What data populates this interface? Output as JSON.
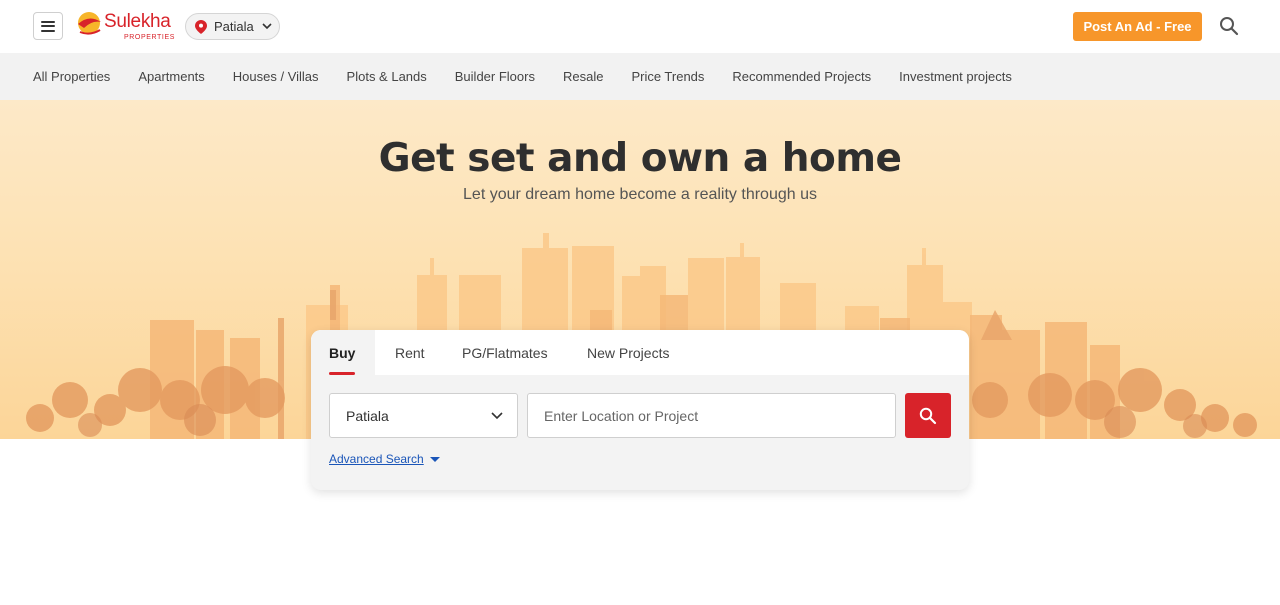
{
  "header": {
    "logo": {
      "name": "Sulekha",
      "sub": "PROPERTIES"
    },
    "city": "Patiala",
    "post_ad_label": "Post An Ad - Free"
  },
  "nav": {
    "items": [
      {
        "label": "All Properties"
      },
      {
        "label": "Apartments"
      },
      {
        "label": "Houses / Villas"
      },
      {
        "label": "Plots & Lands"
      },
      {
        "label": "Builder Floors"
      },
      {
        "label": "Resale"
      },
      {
        "label": "Price Trends"
      },
      {
        "label": "Recommended Projects"
      },
      {
        "label": "Investment projects"
      }
    ]
  },
  "hero": {
    "title": "Get set and own a home",
    "subtitle": "Let your dream home become a reality through us"
  },
  "search": {
    "tabs": [
      {
        "label": "Buy",
        "active": true
      },
      {
        "label": "Rent"
      },
      {
        "label": "PG/Flatmates"
      },
      {
        "label": "New Projects"
      }
    ],
    "city_select": "Patiala",
    "location_placeholder": "Enter Location or Project",
    "advanced_label": "Advanced Search"
  },
  "colors": {
    "brand_red": "#d8232a",
    "accent_orange": "#f7962a",
    "link_blue": "#1a55b8"
  },
  "icons": [
    "menu-icon",
    "location-pin-icon",
    "chevron-down-icon",
    "search-icon",
    "caret-down-icon"
  ]
}
